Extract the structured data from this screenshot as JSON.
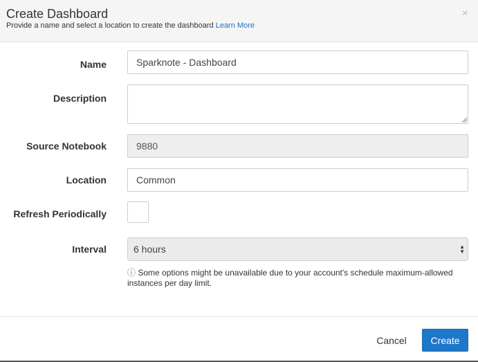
{
  "dialog": {
    "title": "Create Dashboard",
    "subtitle": "Provide a name and select a location to create the dashboard",
    "learn_more": "Learn More",
    "close_icon": "×"
  },
  "form": {
    "name_label": "Name",
    "name_value": "Sparknote - Dashboard",
    "description_label": "Description",
    "description_value": "",
    "source_label": "Source Notebook",
    "source_value": "9880",
    "location_label": "Location",
    "location_value": "Common",
    "refresh_label": "Refresh Periodically",
    "refresh_checked": false,
    "interval_label": "Interval",
    "interval_value": "6 hours",
    "note_icon": "ⓘ",
    "note_text": "Some options might be unavailable due to your account's schedule maximum-allowed instances per day limit."
  },
  "footer": {
    "cancel_label": "Cancel",
    "create_label": "Create"
  },
  "colors": {
    "primary": "#1f77c9",
    "link": "#1a73c9",
    "header_bg": "#f5f5f5"
  }
}
